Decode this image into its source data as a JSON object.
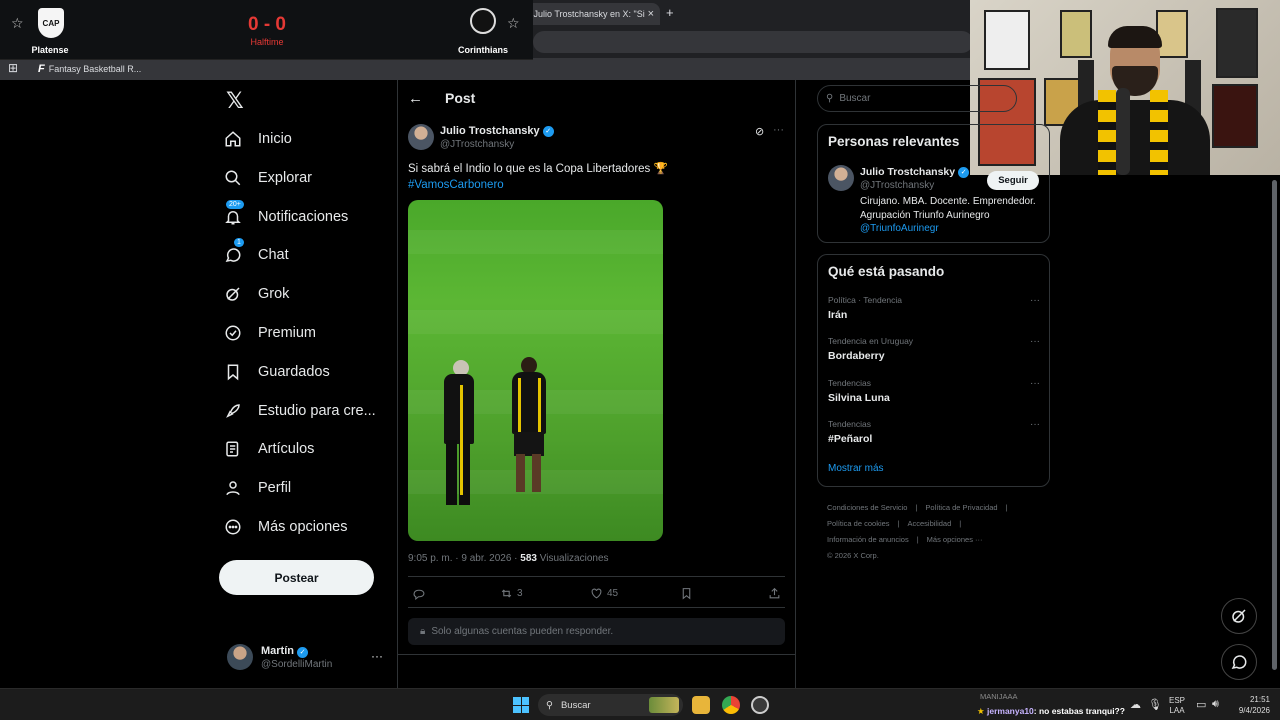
{
  "browser": {
    "tab_title": ") Julio Trostchansky en X: \"Si",
    "tab_close": "×",
    "new_tab": "+",
    "bookmark_label": "Fantasy Basketball R..."
  },
  "scoreboard": {
    "home_team": "Platense",
    "home_abbr": "CAP",
    "away_team": "Corinthians",
    "score": "0 - 0",
    "status": "Halftime",
    "accent_color": "#e53935"
  },
  "nav": {
    "items": [
      {
        "label": "Inicio",
        "icon": "home-icon"
      },
      {
        "label": "Explorar",
        "icon": "search-icon"
      },
      {
        "label": "Notificaciones",
        "icon": "bell-icon",
        "badge": "20+"
      },
      {
        "label": "Chat",
        "icon": "chat-icon",
        "badge": "1"
      },
      {
        "label": "Grok",
        "icon": "grok-icon"
      },
      {
        "label": "Premium",
        "icon": "premium-icon"
      },
      {
        "label": "Guardados",
        "icon": "bookmark-icon"
      },
      {
        "label": "Estudio para cre...",
        "icon": "rocket-icon"
      },
      {
        "label": "Artículos",
        "icon": "article-icon"
      },
      {
        "label": "Perfil",
        "icon": "person-icon"
      },
      {
        "label": "Más opciones",
        "icon": "more-circle-icon"
      }
    ],
    "post_button": "Postear"
  },
  "account": {
    "name": "Martín",
    "handle": "@SordelliMartin",
    "more": "···"
  },
  "post": {
    "header_title": "Post",
    "author_name": "Julio Trostchansky",
    "author_handle": "@JTrostchansky",
    "text": "Si sabrá el Indio lo que es la Copa Libertadores 🏆",
    "hashtag": "#VamosCarbonero",
    "timestamp": "9:05 p. m. · 9 abr. 2026 ·",
    "views_count": "583",
    "views_label": "Visualizaciones",
    "retweets": "3",
    "likes": "45",
    "reply_limit": "Solo algunas cuentas pueden responder.",
    "more": "···"
  },
  "sidebar": {
    "search_placeholder": "Buscar",
    "relevant_title": "Personas relevantes",
    "relevant_person": {
      "name": "Julio Trostchansky",
      "handle": "@JTrostchansky",
      "follow": "Seguir",
      "bio": "Cirujano. MBA. Docente. Emprendedor. Agrupación Triunfo Aurinegro ",
      "bio_link": "@TriunfoAurinegr"
    },
    "trending_title": "Qué está pasando",
    "trends": [
      {
        "category": "Política · Tendencia",
        "name": "Irán"
      },
      {
        "category": "Tendencia en Uruguay",
        "name": "Bordaberry"
      },
      {
        "category": "Tendencias",
        "name": "Silvina Luna"
      },
      {
        "category": "Tendencias",
        "name": "#Peñarol"
      }
    ],
    "trend_more": "···",
    "show_more": "Mostrar más",
    "footer": {
      "terms": "Condiciones de Servicio",
      "privacy": "Política de Privacidad",
      "cookies": "Política de cookies",
      "accessibility": "Accesibilidad",
      "ads": "Información de anuncios",
      "more": "Más opciones ···",
      "copyright": "© 2026 X Corp."
    }
  },
  "taskbar": {
    "search": "Buscar",
    "chat_top": "MANIJAAA",
    "chat_user": "jermanya10",
    "chat_message": ": no estabas tranqui??",
    "lang_top": "ESP",
    "lang_bottom": "LAA",
    "time": "21:51",
    "date": "9/4/2026"
  },
  "colors": {
    "accent": "#1d9bf0",
    "background": "#000000",
    "text": "#e7e9ea",
    "muted": "#71767b"
  }
}
